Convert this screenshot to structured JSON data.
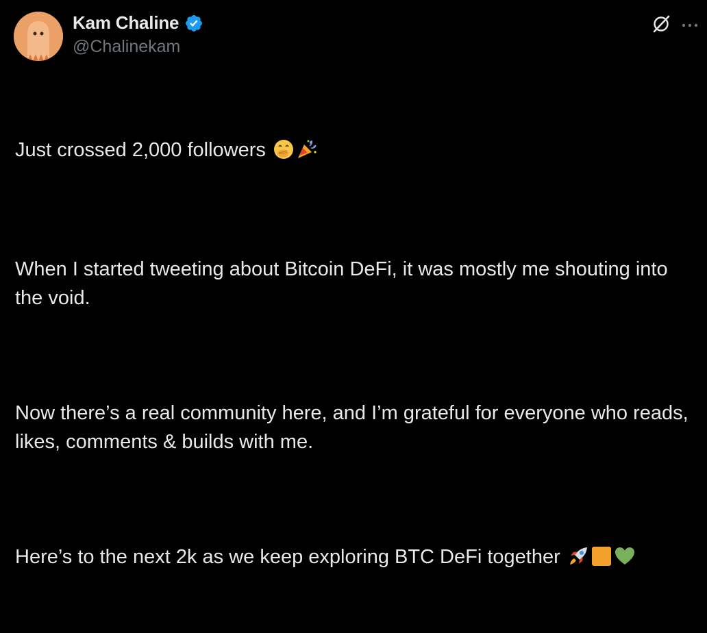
{
  "author": {
    "display_name": "Kam Chaline",
    "handle": "@Chalinekam",
    "verified": true
  },
  "icons": {
    "avatar": "orange-ghost-avatar",
    "verified": "verified-badge-icon",
    "grok": "grok-slash-circle-icon",
    "more": "more-dots-icon"
  },
  "tweet": {
    "p1": "Just crossed 2,000 followers",
    "p2": "When I started tweeting about Bitcoin DeFi, it was mostly me shouting into the void.",
    "p3": "Now there’s a real community here, and I’m grateful for everyone who reads, likes, comments & builds with me.",
    "p4": "Here’s to the next 2k as we keep exploring BTC DeFi together"
  },
  "colors": {
    "background": "#000000",
    "text": "#e7e9ea",
    "secondary": "#71767b",
    "verified_blue": "#1d9bf0",
    "bitcoin_orange": "#f7931a",
    "heart_green": "#78b159"
  }
}
